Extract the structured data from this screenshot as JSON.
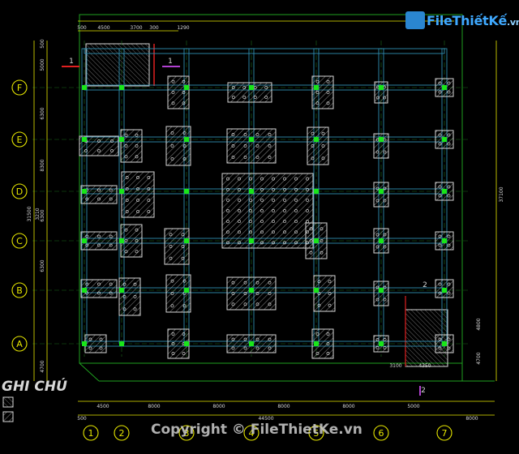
{
  "watermark": {
    "brand": "FileThiếtKế",
    "domain": ".vn",
    "copyright": "Copyright © FileThietKe.vn"
  },
  "notes": {
    "title": "GHI CHÚ",
    "legend": [
      "",
      ""
    ]
  },
  "top_dims": [
    "500",
    "4500",
    "3700",
    "300",
    "1290"
  ],
  "bottom_dims": [
    "4500",
    "8000",
    "8000",
    "8000",
    "8000",
    "5000",
    "500",
    "44500",
    "8000"
  ],
  "bottom_sub_dims": [
    "3100",
    "4350"
  ],
  "left_dims": [
    "500",
    "5000",
    "6300",
    "8300",
    "6300",
    "6300",
    "3210",
    "31500",
    "4700"
  ],
  "right_dims": [
    "37100",
    "4800",
    "4700"
  ],
  "row_axes": [
    "F",
    "E",
    "D",
    "C",
    "B",
    "A"
  ],
  "col_axes": [
    "1",
    "2",
    "3",
    "4",
    "5",
    "6",
    "7"
  ],
  "section_marks": [
    "1",
    "1",
    "2",
    "2"
  ],
  "colors": {
    "beam": "#2f8fb0",
    "footing": "#d8d8d8",
    "dim": "#e6e600",
    "axis": "#19e619",
    "frame": "#1fa01f",
    "red": "#e02020",
    "column": "#19e619",
    "text": "#d8d8d8"
  }
}
